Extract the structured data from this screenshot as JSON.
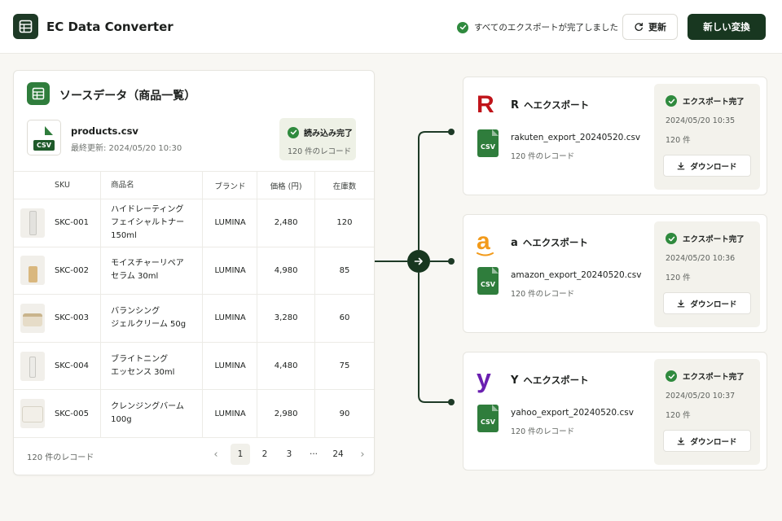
{
  "header": {
    "app_title": "EC Data Converter",
    "status_text": "すべてのエクスポートが完了しました",
    "refresh_label": "更新",
    "new_conversion_label": "新しい変換"
  },
  "source": {
    "title": "ソースデータ（商品一覧）",
    "file_name": "products.csv",
    "file_tag": "CSV",
    "last_updated": "最終更新: 2024/05/20 10:30",
    "load_status": "読み込み完了",
    "record_count": "120 件のレコード",
    "columns": [
      "SKU",
      "商品名",
      "ブランド",
      "価格 (円)",
      "在庫数"
    ],
    "rows": [
      {
        "sku": "SKC-001",
        "name_line1": "ハイドレーティング",
        "name_line2": "フェイシャルトナー150ml",
        "brand": "LUMINA",
        "price": "2,480",
        "stock": "120",
        "thumb": "bottle-tall"
      },
      {
        "sku": "SKC-002",
        "name_line1": "モイスチャーリペア",
        "name_line2": "セラム 30ml",
        "brand": "LUMINA",
        "price": "4,980",
        "stock": "85",
        "thumb": "dropper"
      },
      {
        "sku": "SKC-003",
        "name_line1": "バランシング",
        "name_line2": "ジェルクリーム 50g",
        "brand": "LUMINA",
        "price": "3,280",
        "stock": "60",
        "thumb": "jar"
      },
      {
        "sku": "SKC-004",
        "name_line1": "ブライトニング",
        "name_line2": "エッセンス 30ml",
        "brand": "LUMINA",
        "price": "4,480",
        "stock": "75",
        "thumb": "bottle-small"
      },
      {
        "sku": "SKC-005",
        "name_line1": "クレンジングバーム 100g",
        "name_line2": "",
        "brand": "LUMINA",
        "price": "2,980",
        "stock": "90",
        "thumb": "jar-wide"
      }
    ],
    "footer_count": "120 件のレコード",
    "pagination": {
      "prev": "‹",
      "pages": [
        "1",
        "2",
        "3",
        "···",
        "24"
      ],
      "current": "1",
      "next": "›"
    }
  },
  "exports": [
    {
      "logo_letter": "R",
      "logo_color": "#c0141a",
      "title_letter": "R",
      "title": "ヘエクスポート",
      "file_name": "rakuten_export_20240520.csv",
      "file_tag": "CSV",
      "records": "120 件のレコード",
      "status": "エクスポート完了",
      "timestamp": "2024/05/20 10:35",
      "count": "120 件",
      "download_label": "ダウンロード"
    },
    {
      "logo_letter": "a",
      "logo_color": "#f29a1a",
      "title_letter": "a",
      "title": "ヘエクスポート",
      "file_name": "amazon_export_20240520.csv",
      "file_tag": "CSV",
      "records": "120 件のレコード",
      "status": "エクスポート完了",
      "timestamp": "2024/05/20 10:36",
      "count": "120 件",
      "download_label": "ダウンロード"
    },
    {
      "logo_letter": "y",
      "logo_color": "#6a1fb0",
      "title_letter": "Y",
      "title": "ヘエクスポート",
      "file_name": "yahoo_export_20240520.csv",
      "file_tag": "CSV",
      "records": "120 件のレコード",
      "status": "エクスポート完了",
      "timestamp": "2024/05/20 10:37",
      "count": "120 件",
      "download_label": "ダウンロード"
    }
  ],
  "colors": {
    "primary": "#183720",
    "success": "#2f8a3e",
    "csv_green": "#2f7d3c",
    "background": "#f8f7f3"
  }
}
